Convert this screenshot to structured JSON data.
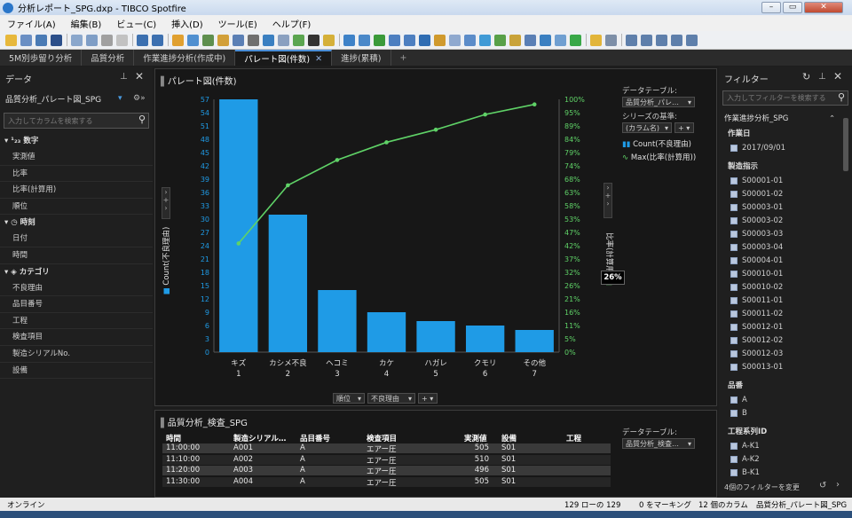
{
  "window": {
    "title": "分析レポート_SPG.dxp - TIBCO Spotfire",
    "min": "–",
    "max": "▭",
    "close": "✕"
  },
  "menu": [
    "ファイル(A)",
    "編集(B)",
    "ビュー(C)",
    "挿入(D)",
    "ツール(E)",
    "ヘルプ(F)"
  ],
  "tabs": [
    {
      "label": "5M別歩留り分析",
      "active": false
    },
    {
      "label": "品質分析",
      "active": false
    },
    {
      "label": "作業進捗分析(作成中)",
      "active": false
    },
    {
      "label": "パレート図(件数)",
      "active": true
    },
    {
      "label": "進捗(累積)",
      "active": false
    }
  ],
  "tab_add": "+",
  "tab_close": "✕",
  "data_panel": {
    "title": "データ",
    "table_select": "品質分析_パレート図_SPG",
    "search_placeholder": "入力してカラムを検索する",
    "groups": [
      {
        "label": "¹₂₃ 数字",
        "items": [
          "実測値",
          "比率",
          "比率(計算用)",
          "順位"
        ]
      },
      {
        "label": "時刻",
        "items": [
          "日付",
          "時間"
        ]
      },
      {
        "label": "カテゴリ",
        "items": [
          "不良理由",
          "品目番号",
          "工程",
          "検査項目",
          "製造シリアルNo.",
          "設備"
        ]
      }
    ]
  },
  "viz": {
    "title": "パレート図(件数)",
    "left_axis_label": "Count(不良理由)",
    "right_axis_label": "比率(計算用)",
    "tooltip": "26%",
    "legend": {
      "table_label": "データテーブル:",
      "table_value": "品質分析_パレ…",
      "series_label": "シリーズの基準:",
      "series_value": "(カラム名)",
      "items": [
        "Count(不良理由)",
        "Max(比率(計算用))"
      ]
    },
    "x_controls": [
      "順位",
      "不良理由",
      "+"
    ]
  },
  "chart_data": {
    "type": "bar",
    "categories": [
      "キズ",
      "カシメ不良",
      "ヘコミ",
      "カケ",
      "ハガレ",
      "クモリ",
      "その他"
    ],
    "ranks": [
      "1",
      "2",
      "3",
      "4",
      "5",
      "6",
      "7"
    ],
    "values": [
      57,
      31,
      14,
      9,
      7,
      6,
      5
    ],
    "line_values": [
      43,
      66,
      76,
      83,
      88,
      94,
      98
    ],
    "yticks": [
      0,
      3,
      6,
      9,
      12,
      15,
      18,
      21,
      24,
      27,
      30,
      33,
      36,
      39,
      42,
      45,
      48,
      51,
      54,
      57
    ],
    "y2ticks": [
      "0%",
      "5%",
      "11%",
      "16%",
      "21%",
      "26%",
      "32%",
      "37%",
      "42%",
      "47%",
      "53%",
      "58%",
      "63%",
      "68%",
      "74%",
      "79%",
      "84%",
      "89%",
      "95%",
      "100%"
    ],
    "ylim": [
      0,
      57
    ],
    "y2lim": [
      0,
      100
    ],
    "bar_color": "#1f9be6",
    "line_color": "#5fd267"
  },
  "table_viz": {
    "title": "品質分析_検査_SPG",
    "headers": [
      "時間",
      "製造シリアル…",
      "品目番号",
      "検査項目",
      "実測値",
      "設備",
      "工程"
    ],
    "rows": [
      [
        "11:00:00",
        "A001",
        "A",
        "エアー圧",
        "505",
        "S01",
        ""
      ],
      [
        "11:10:00",
        "A002",
        "A",
        "エアー圧",
        "510",
        "S01",
        ""
      ],
      [
        "11:20:00",
        "A003",
        "A",
        "エアー圧",
        "496",
        "S01",
        ""
      ],
      [
        "11:30:00",
        "A004",
        "A",
        "エアー圧",
        "505",
        "S01",
        ""
      ]
    ],
    "legend_label": "データテーブル:",
    "legend_value": "品質分析_検査…"
  },
  "filter_panel": {
    "title": "フィルター",
    "search_placeholder": "入力してフィルターを検索する",
    "table": "作業進捗分析_SPG",
    "sections": [
      {
        "label": "作業日",
        "items": [
          "2017/09/01"
        ]
      },
      {
        "label": "製造指示",
        "items": [
          "S00001-01",
          "S00001-02",
          "S00003-01",
          "S00003-02",
          "S00003-03",
          "S00003-04",
          "S00004-01",
          "S00010-01",
          "S00010-02",
          "S00011-01",
          "S00011-02",
          "S00012-01",
          "S00012-02",
          "S00012-03",
          "S00013-01"
        ]
      },
      {
        "label": "品番",
        "items": [
          "A",
          "B"
        ]
      },
      {
        "label": "工程系列ID",
        "items": [
          "A-K1",
          "A-K2",
          "B-K1"
        ]
      }
    ],
    "footer": "4個のフィルターを変更"
  },
  "status": {
    "left": "オンライン",
    "rows": "129 ローの 129",
    "marking": "0 をマーキング",
    "columns": "12 個のカラム",
    "table": "品質分析_パレート図_SPG"
  }
}
